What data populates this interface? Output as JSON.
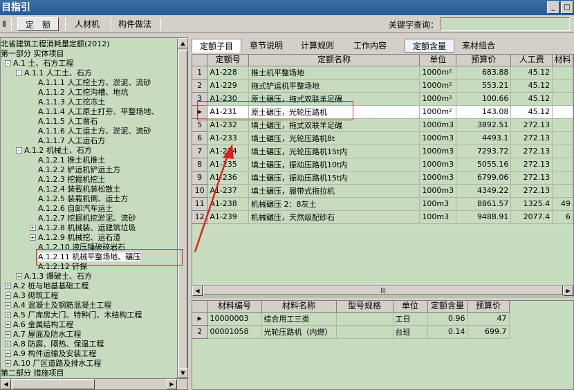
{
  "window": {
    "title": "目指引",
    "min_btn": "_",
    "max_btn": "□"
  },
  "toolbar": {
    "left_stub": "Ⅱ",
    "buttons": [
      {
        "label": "定　额",
        "active": true
      },
      {
        "label": "人材机",
        "active": false
      },
      {
        "label": "构件做法",
        "active": false
      }
    ],
    "keyword_label": "关键字查询：",
    "keyword_value": ""
  },
  "tree": {
    "nodes": [
      {
        "text": "北省建筑工程消耗量定额(2012)",
        "level": 0,
        "expander": ""
      },
      {
        "text": "第一部分 实体项目",
        "level": 0,
        "expander": ""
      },
      {
        "text": "A.1 土、石方工程",
        "level": 1,
        "expander": "-"
      },
      {
        "text": "A.1.1 人工土、石方",
        "level": 2,
        "expander": "-"
      },
      {
        "text": "A.1.1.1 人工挖土方、淤泥、流砂",
        "level": 3,
        "expander": ""
      },
      {
        "text": "A.1.1.2 人工挖沟槽、地坑",
        "level": 3,
        "expander": ""
      },
      {
        "text": "A.1.1.3 人工挖冻土",
        "level": 3,
        "expander": ""
      },
      {
        "text": "A.1.1.4 人工原土打夯、平整场地、",
        "level": 3,
        "expander": ""
      },
      {
        "text": "A.1.1.5 人工凿石",
        "level": 3,
        "expander": ""
      },
      {
        "text": "A.1.1.6 人工运土方、淤泥、流砂",
        "level": 3,
        "expander": ""
      },
      {
        "text": "A.1.1.7 人工运石方",
        "level": 3,
        "expander": ""
      },
      {
        "text": "A.1.2 机械土、石方",
        "level": 2,
        "expander": "-"
      },
      {
        "text": "A.1.2.1 推土机推土",
        "level": 3,
        "expander": ""
      },
      {
        "text": "A.1.2.2 铲运机铲运土方",
        "level": 3,
        "expander": ""
      },
      {
        "text": "A.1.2.3 挖掘机挖土",
        "level": 3,
        "expander": ""
      },
      {
        "text": "A.1.2.4 装载机装松散土",
        "level": 3,
        "expander": ""
      },
      {
        "text": "A.1.2.5 装载机倒、运土方",
        "level": 3,
        "expander": ""
      },
      {
        "text": "A.1.2.6 自卸汽车运土",
        "level": 3,
        "expander": ""
      },
      {
        "text": "A.1.2.7 挖掘机挖淤泥、流砂",
        "level": 3,
        "expander": ""
      },
      {
        "text": "A.1.2.8 机械装、运建筑垃圾",
        "level": 3,
        "expander": "+"
      },
      {
        "text": "A.1.2.9 机械挖、运石渣",
        "level": 3,
        "expander": "+"
      },
      {
        "text": "A.1.2.10 液压锤破碎岩石",
        "level": 3,
        "expander": ""
      },
      {
        "text": "A.1.2.11 机械平整场地、碾压",
        "level": 3,
        "expander": "",
        "selected": true
      },
      {
        "text": "A.1.2.12 钎探",
        "level": 3,
        "expander": ""
      },
      {
        "text": "A.1.3 爆破土、石方",
        "level": 2,
        "expander": "+"
      },
      {
        "text": "A.2 桩与地基基础工程",
        "level": 1,
        "expander": "+"
      },
      {
        "text": "A.3 砌筑工程",
        "level": 1,
        "expander": "+"
      },
      {
        "text": "A.4 混凝土及钢筋混凝土工程",
        "level": 1,
        "expander": "+"
      },
      {
        "text": "A.5 厂库房大门、特种门、木结构工程",
        "level": 1,
        "expander": "+"
      },
      {
        "text": "A.6 金属结构工程",
        "level": 1,
        "expander": "+"
      },
      {
        "text": "A.7 屋面及防水工程",
        "level": 1,
        "expander": "+"
      },
      {
        "text": "A.8 防腐、隔热、保温工程",
        "level": 1,
        "expander": "+"
      },
      {
        "text": "A.9 构件运输及安装工程",
        "level": 1,
        "expander": "+"
      },
      {
        "text": "A.10 厂区道路及排水工程",
        "level": 1,
        "expander": "+"
      },
      {
        "text": "第二部分 措施项目",
        "level": 0,
        "expander": ""
      }
    ]
  },
  "tabs": {
    "left": [
      "定额子目",
      "章节说明",
      "计算规则",
      "工作内容"
    ],
    "right": [
      "定额含量",
      "来材组合"
    ]
  },
  "quota_table": {
    "headers": [
      "",
      "定额号",
      "定额名称",
      "单位",
      "预算价",
      "人工费",
      "材料"
    ],
    "rows": [
      {
        "n": "1",
        "code": "A1-228",
        "name": "推土机平整场地",
        "unit": "1000m²",
        "price": "683.88",
        "labor": "45.12",
        "mat": ""
      },
      {
        "n": "2",
        "code": "A1-229",
        "name": "拖式铲运机平整场地",
        "unit": "1000m²",
        "price": "553.21",
        "labor": "45.12",
        "mat": ""
      },
      {
        "n": "3",
        "code": "A1-230",
        "name": "原土碾压，拖式双联羊足碾",
        "unit": "1000m²",
        "price": "100.66",
        "labor": "45.12",
        "mat": ""
      },
      {
        "n": "▶",
        "code": "A1-231",
        "name": "原土碾压，光轮压路机",
        "unit": "1000m²",
        "price": "143.08",
        "labor": "45.12",
        "mat": "",
        "selected": true
      },
      {
        "n": "5",
        "code": "A1-232",
        "name": "填土碾压，拖式双联羊足碾",
        "unit": "1000m3",
        "price": "3892.51",
        "labor": "272.13",
        "mat": ""
      },
      {
        "n": "6",
        "code": "A1-233",
        "name": "填土碾压，光轮压路机8t",
        "unit": "1000m3",
        "price": "4493.1",
        "labor": "272.13",
        "mat": ""
      },
      {
        "n": "7",
        "code": "A1-234",
        "name": "填土碾压，光轮压路机15t内",
        "unit": "1000m3",
        "price": "7293.72",
        "labor": "272.13",
        "mat": ""
      },
      {
        "n": "8",
        "code": "A1-235",
        "name": "填土碾压，振动压路机10t内",
        "unit": "1000m3",
        "price": "5055.16",
        "labor": "272.13",
        "mat": ""
      },
      {
        "n": "9",
        "code": "A1-236",
        "name": "填土碾压，振动压路机15t内",
        "unit": "1000m3",
        "price": "6799.06",
        "labor": "272.13",
        "mat": ""
      },
      {
        "n": "10",
        "code": "A1-237",
        "name": "填土碾压，履带式拖拉机",
        "unit": "1000m3",
        "price": "4349.22",
        "labor": "272.13",
        "mat": ""
      },
      {
        "n": "11",
        "code": "A1-238",
        "name": "机械碾压 2：8灰土",
        "unit": "100m3",
        "price": "8861.57",
        "labor": "1325.4",
        "mat": "49"
      },
      {
        "n": "12",
        "code": "A1-239",
        "name": "机械碾压，天然级配砂石",
        "unit": "100m3",
        "price": "9488.91",
        "labor": "2077.4",
        "mat": "6"
      }
    ]
  },
  "material_table": {
    "headers": [
      "",
      "材料编号",
      "材料名称",
      "型号规格",
      "单位",
      "定额含量",
      "预算价"
    ],
    "rows": [
      {
        "n": "▶",
        "code": "10000003",
        "name": "综合用工三类",
        "spec": "",
        "unit": "工日",
        "qty": "0.96",
        "price": "47"
      },
      {
        "n": "2",
        "code": "00001058",
        "name": "光轮压路机（内燃）",
        "spec": "",
        "unit": "台班",
        "qty": "0.14",
        "price": "699.7"
      }
    ]
  },
  "annotation_colors": {
    "highlight": "#e02020"
  },
  "scroll_arrows": {
    "up": "▲",
    "down": "▼",
    "left": "◀",
    "right": "▶",
    "grip": "|||"
  }
}
